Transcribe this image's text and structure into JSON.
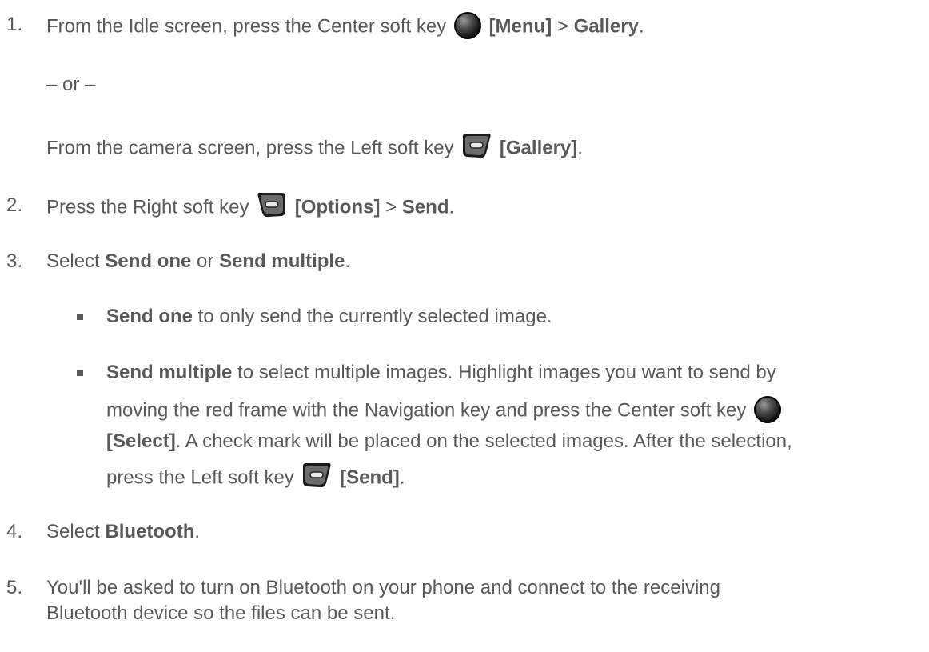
{
  "steps": {
    "s1": {
      "num": "1.",
      "a": "From the Idle screen, press the Center soft key",
      "b": "[Menu]",
      "c": " > ",
      "d": "Gallery",
      "e": "."
    },
    "or": "– or –",
    "s1b": {
      "a": "From the camera screen, press the Left soft key",
      "b": "[Gallery]",
      "c": "."
    },
    "s2": {
      "num": "2.",
      "a": "Press the Right soft key",
      "b": "[Options]",
      "c": " > ",
      "d": "Send",
      "e": "."
    },
    "s3": {
      "num": "3.",
      "a": "Select ",
      "b": "Send one",
      "c": " or ",
      "d": "Send multiple",
      "e": "."
    },
    "b1": {
      "a": "Send one",
      "b": " to only send the currently selected image."
    },
    "b2": {
      "a": "Send multiple",
      "b": " to select multiple images. Highlight images you want to send by",
      "c": "moving the red frame with the Navigation key and press the Center soft key",
      "d": "[Select]",
      "e": ". A check mark will be placed on the selected images. After the selection,",
      "f": "press the Left soft key",
      "g": "[Send]",
      "h": "."
    },
    "s4": {
      "num": "4.",
      "a": "Select ",
      "b": "Bluetooth",
      "c": "."
    },
    "s5": {
      "num": "5.",
      "a": "You'll be asked to turn on Bluetooth on your phone and connect to the receiving",
      "b": "Bluetooth device so the files can be sent."
    }
  },
  "icons": {
    "center": "center-soft-key-icon",
    "left": "left-soft-key-icon",
    "right": "right-soft-key-icon"
  }
}
